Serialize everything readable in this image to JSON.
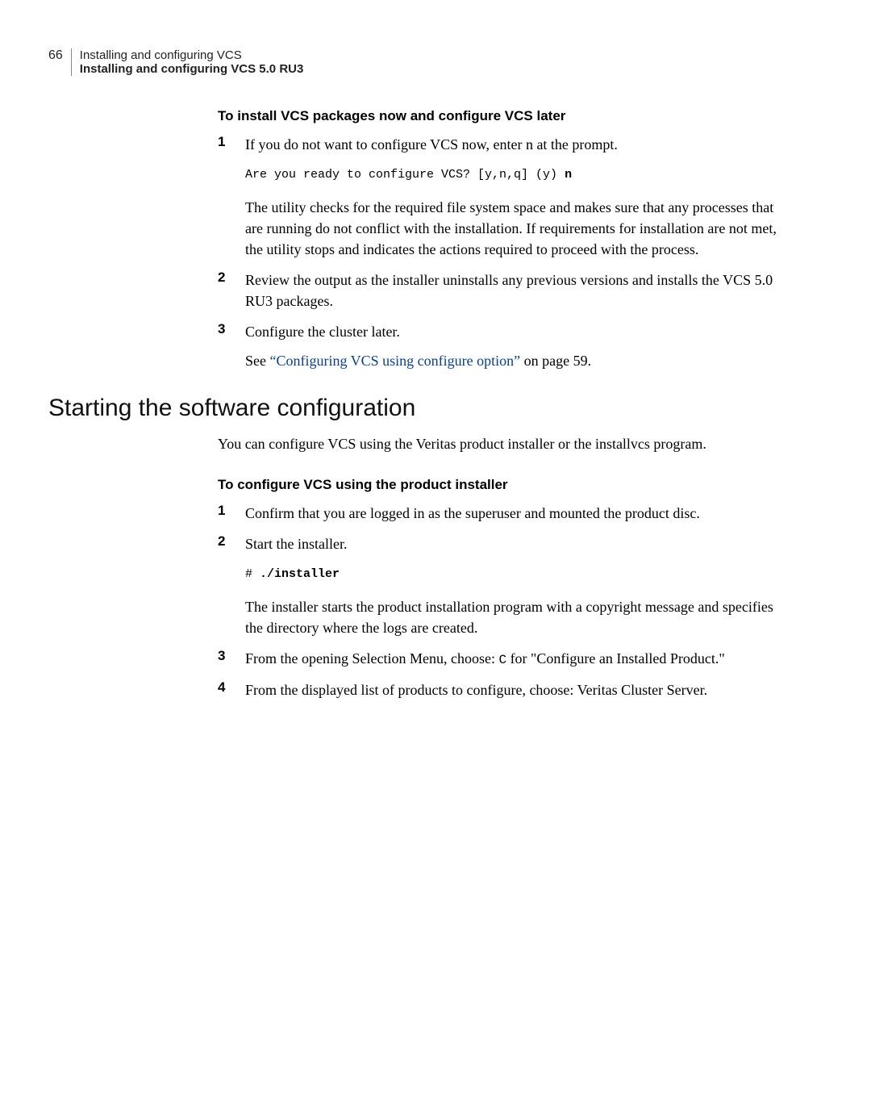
{
  "header": {
    "page_number": "66",
    "line1": "Installing and configuring VCS",
    "line2": "Installing and configuring VCS 5.0 RU3"
  },
  "proc1": {
    "title": "To install VCS packages now and configure VCS later",
    "steps": [
      {
        "num": "1",
        "text": "If you do not want to configure VCS now, enter n at the prompt.",
        "code_plain": "Are you ready to configure VCS? [y,n,q] (y) ",
        "code_bold": "n",
        "after": "The utility checks for the required file system space and makes sure that any processes that are running do not conflict with the installation. If requirements for installation are not met, the utility stops and indicates the actions required to proceed with the process."
      },
      {
        "num": "2",
        "text": "Review the output as the installer uninstalls any previous versions and installs the VCS 5.0 RU3 packages."
      },
      {
        "num": "3",
        "text": "Configure the cluster later.",
        "after_pre": "See ",
        "after_link": "“Configuring VCS using configure option”",
        "after_post": " on page 59."
      }
    ]
  },
  "h2": "Starting the software configuration",
  "intro": "You can configure VCS using the Veritas product installer or the installvcs program.",
  "proc2": {
    "title": "To configure VCS using the product installer",
    "steps": [
      {
        "num": "1",
        "text": "Confirm that you are logged in as the superuser and mounted the product disc."
      },
      {
        "num": "2",
        "text": "Start the installer.",
        "code_plain": "# ",
        "code_bold": "./installer",
        "after": "The installer starts the product installation program with a copyright message and specifies the directory where the logs are created."
      },
      {
        "num": "3",
        "pre": "From the opening Selection Menu, choose: ",
        "code_inline": "C",
        "post": " for \"Configure an Installed Product.\""
      },
      {
        "num": "4",
        "text": "From the displayed list of products to configure, choose: Veritas Cluster Server."
      }
    ]
  }
}
